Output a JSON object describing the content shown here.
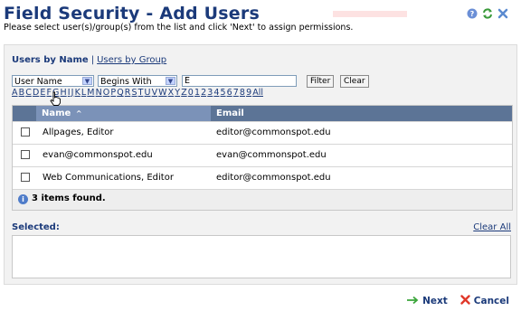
{
  "header": {
    "title": "Field Security - Add Users",
    "subtitle": "Please select user(s)/group(s) from the list and click 'Next' to assign permissions.",
    "icons": [
      "help-icon",
      "refresh-icon",
      "close-icon"
    ],
    "colors": {
      "title": "#1b3a7a",
      "help": "#6b8fd6",
      "refresh": "#3a9a3a",
      "close": "#5b8bd0"
    }
  },
  "tabs": {
    "active": "Users by Name",
    "separator": "|",
    "other": "Users by Group"
  },
  "filters": {
    "field_select": "User Name",
    "operator_select": "Begins With",
    "search_value": "E",
    "filter_button": "Filter",
    "clear_button": "Clear"
  },
  "alphabet": [
    "A",
    "B",
    "C",
    "D",
    "E",
    "F",
    "G",
    "H",
    "I",
    "J",
    "K",
    "L",
    "M",
    "N",
    "O",
    "P",
    "Q",
    "R",
    "S",
    "T",
    "U",
    "V",
    "W",
    "X",
    "Y",
    "Z",
    "0",
    "1",
    "2",
    "3",
    "4",
    "5",
    "6",
    "7",
    "8",
    "9",
    "All"
  ],
  "table": {
    "columns": {
      "name": "Name",
      "sort_indicator": "^",
      "email": "Email"
    },
    "rows": [
      {
        "name": "Allpages, Editor",
        "email": "editor@commonspot.edu"
      },
      {
        "name": "evan@commonspot.edu",
        "email": "evan@commonspot.edu"
      },
      {
        "name": "Web Communications, Editor",
        "email": "editor@commonspot.edu"
      }
    ],
    "status": "3 items found."
  },
  "selected": {
    "label": "Selected:",
    "clear_all": "Clear All"
  },
  "footer": {
    "next_label": "Next",
    "cancel_label": "Cancel",
    "colors": {
      "next_arrow": "#3aa53a",
      "cancel_x": "#e0382a"
    }
  }
}
